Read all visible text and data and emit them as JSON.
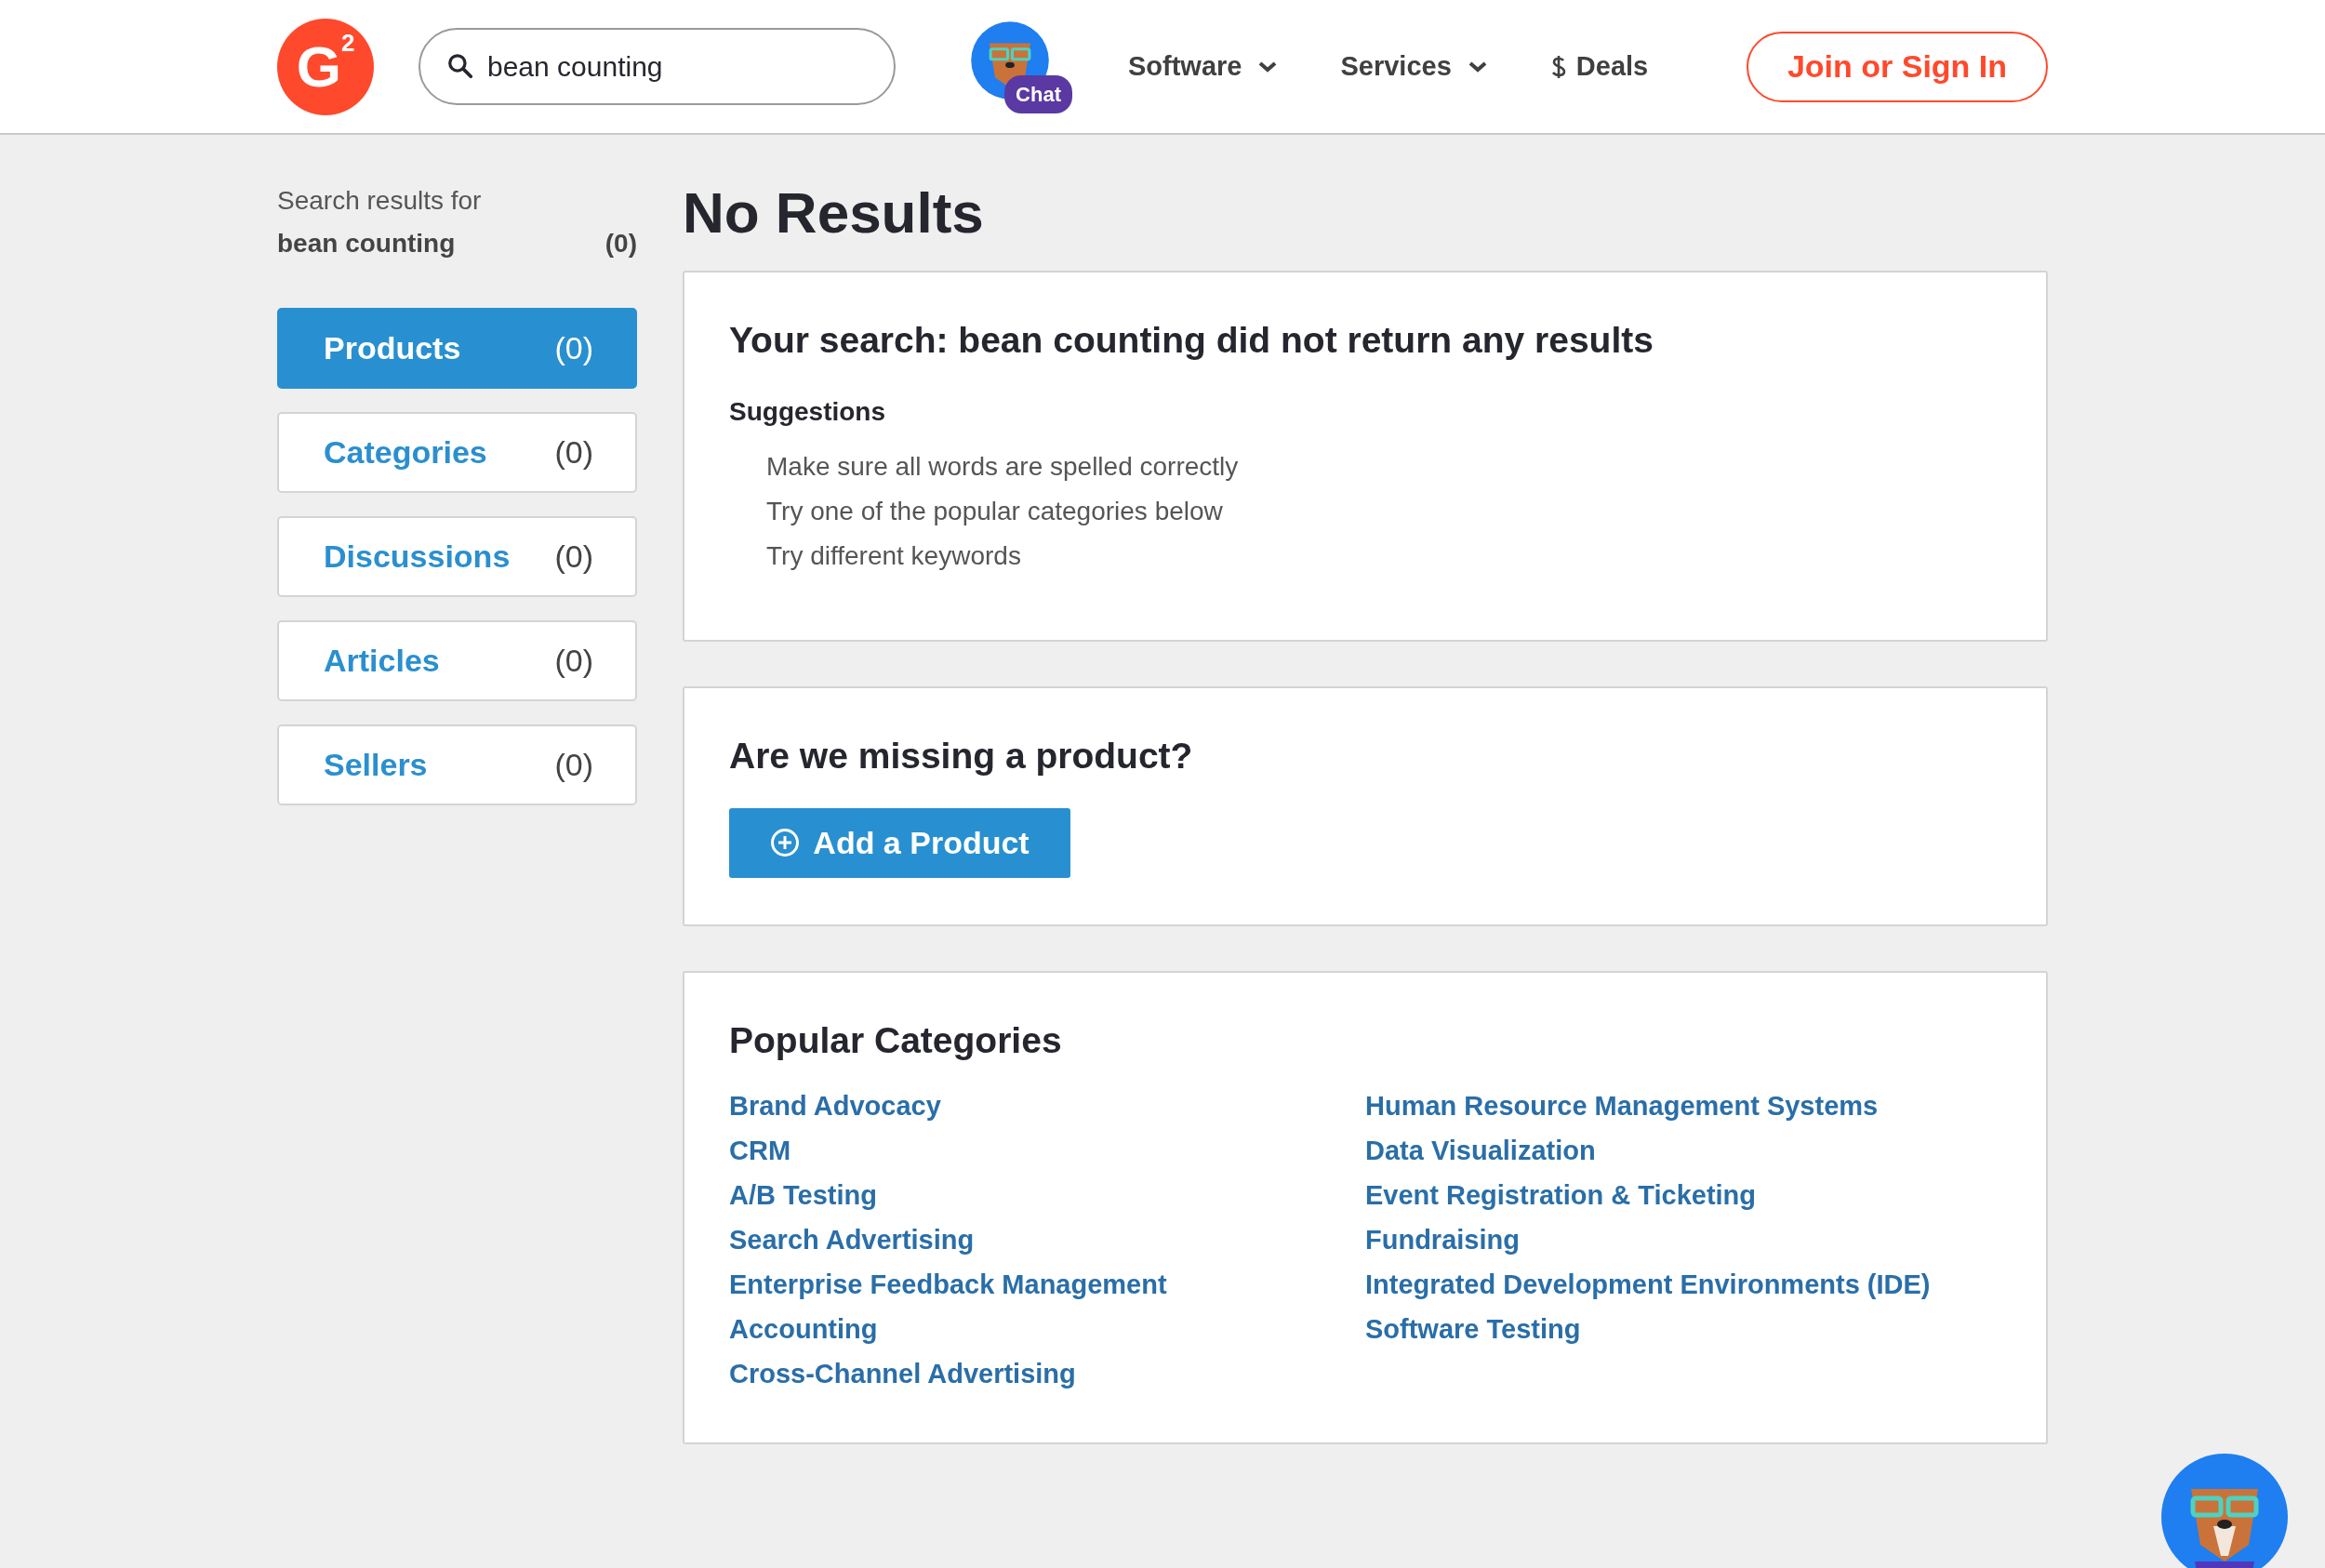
{
  "header": {
    "logo": "G$^{2}$",
    "search": {
      "value": "bean counting"
    },
    "chat_badge": "Chat",
    "nav": [
      {
        "label": "Software",
        "kind": "dropdown"
      },
      {
        "label": "Services",
        "kind": "dropdown"
      },
      {
        "label": "Deals",
        "kind": "deals"
      }
    ],
    "signin_button": "Join or Sign In"
  },
  "sidebar": {
    "caption": "Search results for",
    "query": "bean counting",
    "count": "(0)",
    "items": [
      {
        "label": "Products",
        "count": "(0)",
        "selected": true
      },
      {
        "label": "Categories",
        "count": "(0)",
        "selected": false
      },
      {
        "label": "Discussions",
        "count": "(0)",
        "selected": false
      },
      {
        "label": "Articles",
        "count": "(0)",
        "selected": false
      },
      {
        "label": "Sellers",
        "count": "(0)",
        "selected": false
      }
    ]
  },
  "main": {
    "title": "No Results",
    "no_results_card": {
      "title": "Your search: bean counting did not return any results",
      "subtitle": "Suggestions",
      "suggestions": [
        "Make sure all words are spelled correctly",
        "Try one of the popular categories below",
        "Try different keywords"
      ]
    },
    "missing_card": {
      "title": "Are we missing a product?",
      "button": "Add a Product"
    },
    "popular_card": {
      "title": "Popular Categories",
      "columns": [
        [
          "Brand Advocacy",
          "CRM",
          "A/B Testing",
          "Search Advertising",
          "Enterprise Feedback Management",
          "Accounting",
          "Cross-Channel Advertising"
        ],
        [
          "Human Resource Management Systems",
          "Data Visualization",
          "Event Registration & Ticketing",
          "Fundraising",
          "Integrated Development Environments (IDE)",
          "Software Testing"
        ]
      ]
    }
  }
}
